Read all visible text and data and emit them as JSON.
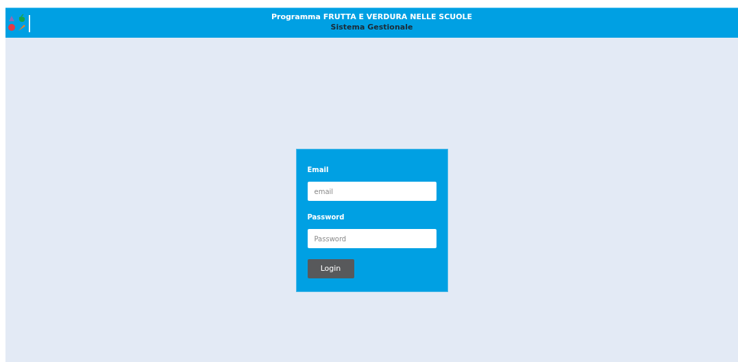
{
  "header": {
    "title": "Programma FRUTTA E VERDURA NELLE SCUOLE",
    "subtitle": "Sistema Gestionale"
  },
  "login_form": {
    "fields": [
      {
        "label": "Email",
        "placeholder": "email"
      },
      {
        "label": "Password",
        "placeholder": "Password"
      }
    ],
    "button": "Login"
  }
}
